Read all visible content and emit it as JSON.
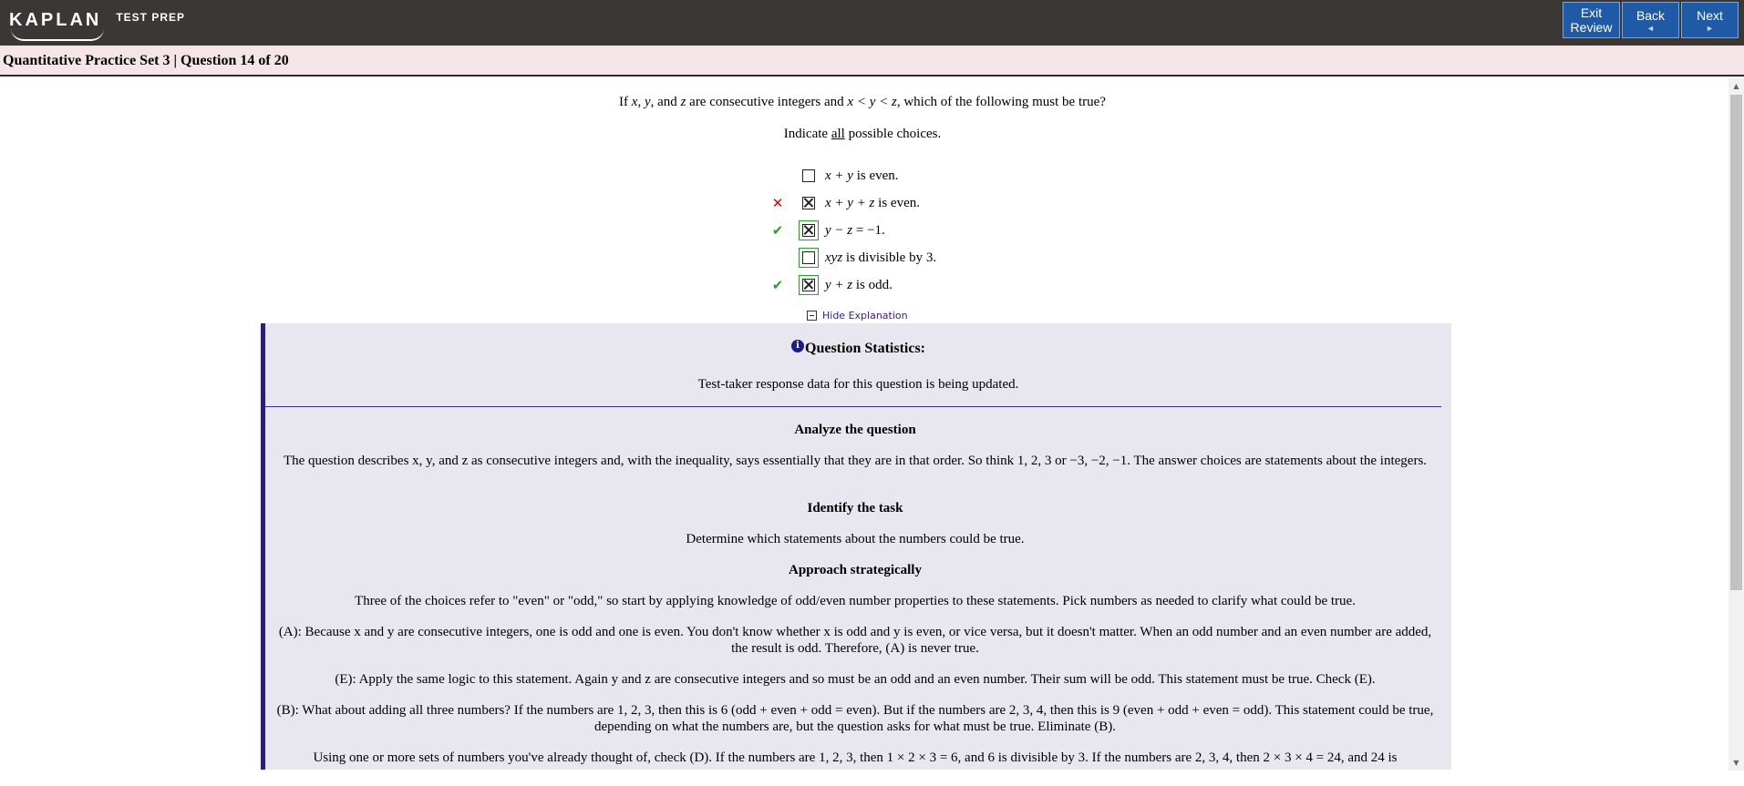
{
  "header": {
    "logo_text": "KAPLAN",
    "logo_sub": "TEST PREP",
    "buttons": [
      {
        "line1": "Exit",
        "line2": "Review"
      },
      {
        "line1": "Back",
        "line2": "◄"
      },
      {
        "line1": "Next",
        "line2": "►"
      }
    ]
  },
  "title": "Quantitative Practice Set 3 | Question 14 of 20",
  "question": {
    "stem_pre": "If ",
    "stem_x": "x",
    "stem_c1": ", ",
    "stem_y": "y",
    "stem_c2": ", and ",
    "stem_z": "z",
    "stem_mid": " are consecutive integers and ",
    "stem_ineq": "x < y < z",
    "stem_post": ", which of the following must be true?",
    "instruction_pre": "Indicate ",
    "instruction_u": "all",
    "instruction_post": " possible choices."
  },
  "choices": [
    {
      "math": "x + y",
      "rest": " is even.",
      "checked": false,
      "mark": "",
      "boxed": false
    },
    {
      "math": "x + y + z",
      "rest": " is even.",
      "checked": true,
      "mark": "✕",
      "boxed": false
    },
    {
      "math": "y − z",
      "rest": " = −1.",
      "checked": true,
      "mark": "✔",
      "boxed": true
    },
    {
      "math": "xyz",
      "rest": " is divisible by 3.",
      "checked": false,
      "mark": "",
      "boxed": true
    },
    {
      "math": "y + z",
      "rest": " is odd.",
      "checked": true,
      "mark": "✔",
      "boxed": true
    }
  ],
  "hide_explanation": "Hide Explanation",
  "explanation": {
    "stats_title": "Question Statistics:",
    "stats_text": "Test-taker response data for this question is being updated.",
    "h1": "Analyze the question",
    "p1": "The question describes x, y, and z as consecutive integers and, with the inequality, says essentially that they are in that order. So think 1, 2, 3 or −3, −2, −1. The answer choices are statements about the integers.",
    "h2": "Identify the task",
    "p2": "Determine which statements about the numbers could be true.",
    "h3": "Approach strategically",
    "p3": "Three of the choices refer to \"even\" or \"odd,\" so start by applying knowledge of odd/even number properties to these statements. Pick numbers as needed to clarify what could be true.",
    "p4": "(A): Because x and y are consecutive integers, one is odd and one is even. You don't know whether x is odd and y is even, or vice versa, but it doesn't matter. When an odd number and an even number are added, the result is odd. Therefore, (A) is never true.",
    "p5": "(E): Apply the same logic to this statement. Again y and z are consecutive integers and so must be an odd and an even number. Their sum will be odd. This statement must be true. Check (E).",
    "p6": "(B): What about adding all three numbers? If the numbers are 1, 2, 3, then this is 6 (odd + even + odd = even). But if the numbers are 2, 3, 4, then this is 9 (even + odd + even = odd). This statement could be true, depending on what the numbers are, but the question asks for what must be true. Eliminate (B).",
    "p7": "Using one or more sets of numbers you've already thought of, check (D). If the numbers are 1, 2, 3, then 1 × 2 × 3 = 6, and 6 is divisible by 3. If the numbers are 2, 3, 4, then 2 × 3 × 4 = 24, and 24 is"
  },
  "colors": {
    "topbar": "#3b3735",
    "nav_button": "#1f5aa6",
    "titlebar": "#f5e4e8",
    "panel": "#e8e7ef",
    "panel_border": "#2b1d78",
    "correct": "#2aa12a",
    "incorrect": "#e00000"
  }
}
